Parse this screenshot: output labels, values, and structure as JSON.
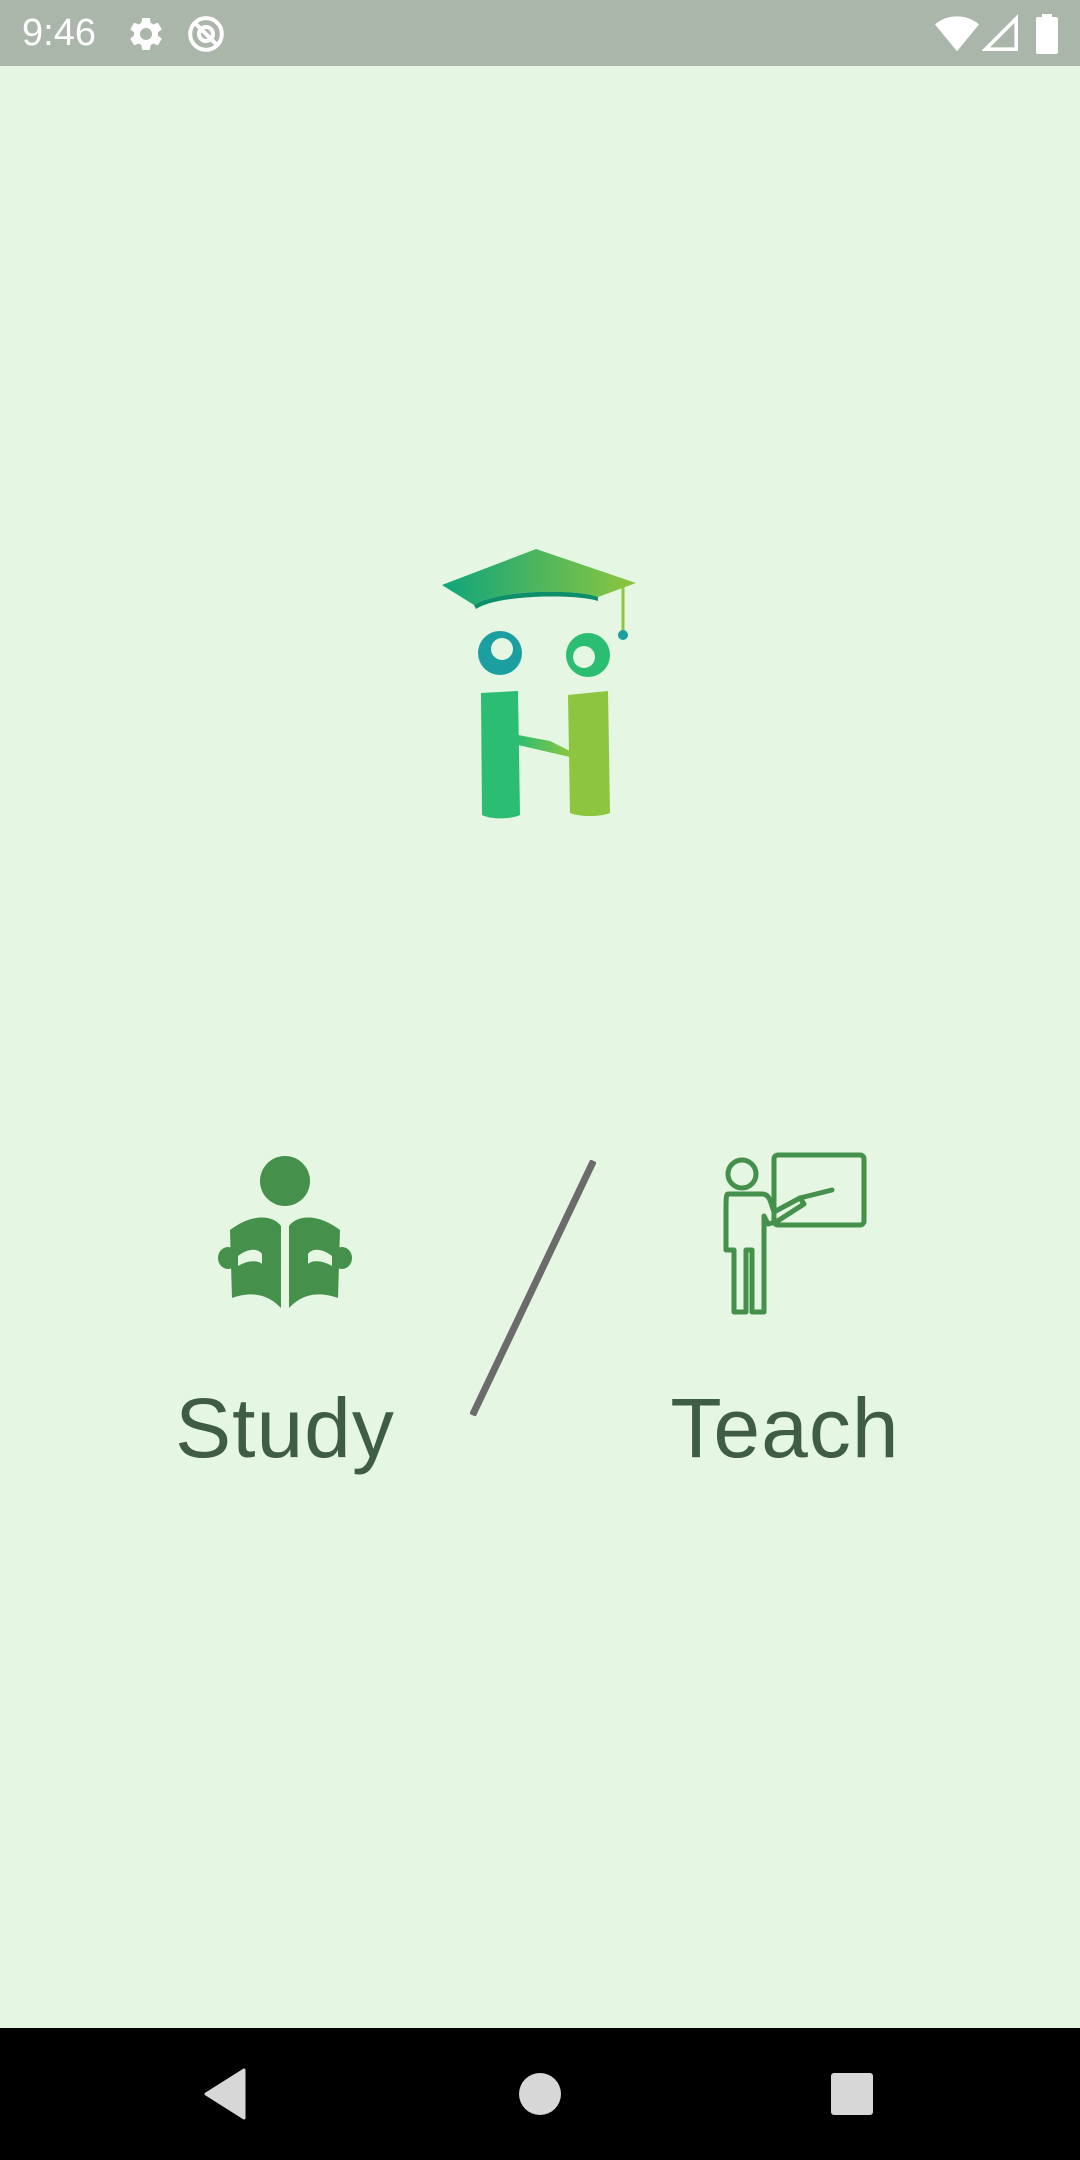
{
  "status_bar": {
    "time": "9:46",
    "icons": [
      "settings-icon",
      "sync-disabled-icon",
      "wifi-icon",
      "cell-signal-icon",
      "battery-icon"
    ]
  },
  "logo": {
    "name": "app-logo",
    "colors": {
      "green_dark": "#1aa874",
      "green_mid": "#2bbd72",
      "green_light": "#8cc63f",
      "teal": "#1b9fa0"
    }
  },
  "choices": {
    "study": {
      "label": "Study",
      "icon": "student-reading-icon"
    },
    "teach": {
      "label": "Teach",
      "icon": "teacher-board-icon"
    }
  },
  "colors": {
    "background": "#e5f6e3",
    "icon_green": "#45904a",
    "label_text": "#3f5d42",
    "divider": "#6b6b6b",
    "status_bar": "#abb6ab",
    "nav_bar": "#000000"
  },
  "nav_bar": {
    "buttons": [
      "back-icon",
      "home-icon",
      "recents-icon"
    ]
  }
}
